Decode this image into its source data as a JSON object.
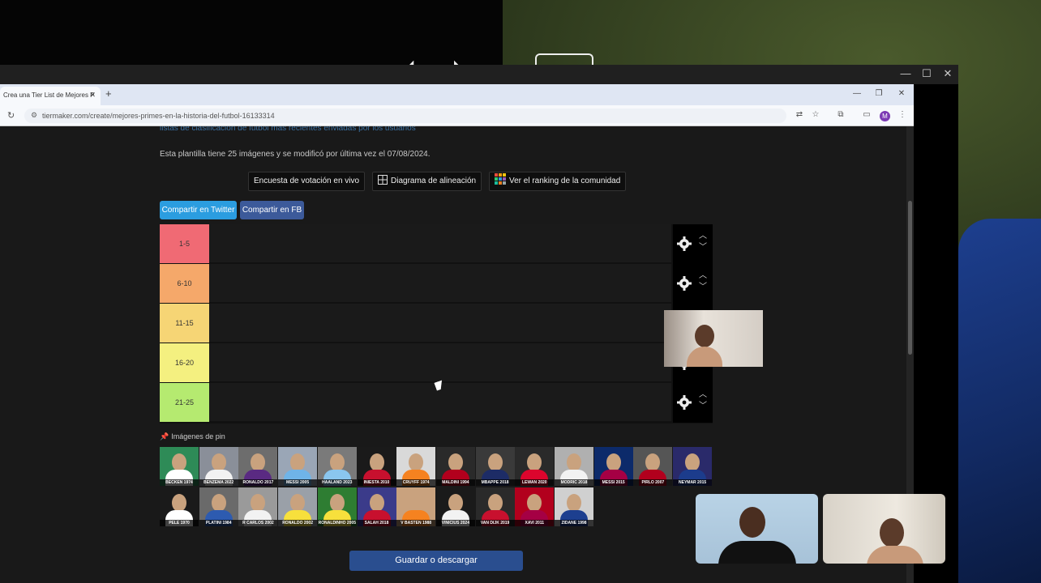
{
  "browser": {
    "tab_title": "Crea una Tier List de Mejores P",
    "url": "tiermaker.com/create/mejores-primes-en-la-historia-del-futbol-16133314",
    "profile_initial": "M"
  },
  "page": {
    "cut_link_text": "listas de clasificación de fútbol más recientes enviadas por los usuarios",
    "template_info": "Esta plantilla tiene 25 imágenes y se modificó por última vez el 07/08/2024.",
    "options": [
      {
        "label": "Encuesta de votación en vivo",
        "icon": "none"
      },
      {
        "label": "Diagrama de alineación",
        "icon": "grid-icon"
      },
      {
        "label": "Ver el ranking de la comunidad",
        "icon": "ranking-icon"
      }
    ],
    "share_twitter": "Compartir en Twitter",
    "share_fb": "Compartir en FB",
    "tiers": [
      {
        "label": "1-5",
        "color": "#f06a74"
      },
      {
        "label": "6-10",
        "color": "#f5a86a"
      },
      {
        "label": "11-15",
        "color": "#f6d575"
      },
      {
        "label": "16-20",
        "color": "#f4f080"
      },
      {
        "label": "21-25",
        "color": "#b5ea70"
      }
    ],
    "pin_title": "Imágenes de pin",
    "players": [
      {
        "caption": "BECKEN 1974",
        "kit": "#ffffff",
        "bg": "#2e8b57"
      },
      {
        "caption": "BENZEMA 2022",
        "kit": "#f2f2f2",
        "bg": "#8a8f99"
      },
      {
        "caption": "RONALDO 2017",
        "kit": "#5a2a82",
        "bg": "#6d6d6d"
      },
      {
        "caption": "MESSI 2005",
        "kit": "#6fb4e8",
        "bg": "#9aa6b6"
      },
      {
        "caption": "HAALAND 2023",
        "kit": "#8ac6ef",
        "bg": "#7a7a7a"
      },
      {
        "caption": "INIESTA 2010",
        "kit": "#c8102e",
        "bg": "#1a1a1a"
      },
      {
        "caption": "CRUYFF 1974",
        "kit": "#f58220",
        "bg": "#d9d9d9"
      },
      {
        "caption": "MALDINI 1994",
        "kit": "#b2001d",
        "bg": "#2a2a2a"
      },
      {
        "caption": "MBAPPE 2018",
        "kit": "#1d2c66",
        "bg": "#3a3a3a"
      },
      {
        "caption": "LEWAN 2020",
        "kit": "#dc052d",
        "bg": "#2a2a2a"
      },
      {
        "caption": "MODRIC 2018",
        "kit": "#f2f2f2",
        "bg": "#b0b0b0"
      },
      {
        "caption": "MESSI 2015",
        "kit": "#a50044",
        "bg": "#0c2a6a"
      },
      {
        "caption": "PIRLO 2007",
        "kit": "#b2001d",
        "bg": "#555555"
      },
      {
        "caption": "NEYMAR 2015",
        "kit": "#1c3c8c",
        "bg": "#2a2a6a"
      },
      {
        "caption": "PELE 1970",
        "kit": "#ffffff",
        "bg": "#1a1a1a"
      },
      {
        "caption": "PLATINI 1984",
        "kit": "#2d5bb0",
        "bg": "#6a6a6a"
      },
      {
        "caption": "R CARLOS 2002",
        "kit": "#f2f2f2",
        "bg": "#9a9a9a"
      },
      {
        "caption": "RONALDO 2002",
        "kit": "#f7e03c",
        "bg": "#9aa0a8"
      },
      {
        "caption": "RONALDINHO 2005",
        "kit": "#f7e03c",
        "bg": "#2e7d32"
      },
      {
        "caption": "SALAH 2018",
        "kit": "#c8102e",
        "bg": "#3b3b8a"
      },
      {
        "caption": "V BASTEN 1988",
        "kit": "#f58220",
        "bg": "#c9a27e"
      },
      {
        "caption": "VINICIUS 2024",
        "kit": "#f2f2f2",
        "bg": "#1a1a1a"
      },
      {
        "caption": "VAN DIJK 2019",
        "kit": "#c8102e",
        "bg": "#2a2a2a"
      },
      {
        "caption": "XAVI 2011",
        "kit": "#a50044",
        "bg": "#b2001d"
      },
      {
        "caption": "ZIDANE 1998",
        "kit": "#1d3f8f",
        "bg": "#d0d0d0"
      }
    ],
    "save_label": "Guardar o descargar"
  }
}
